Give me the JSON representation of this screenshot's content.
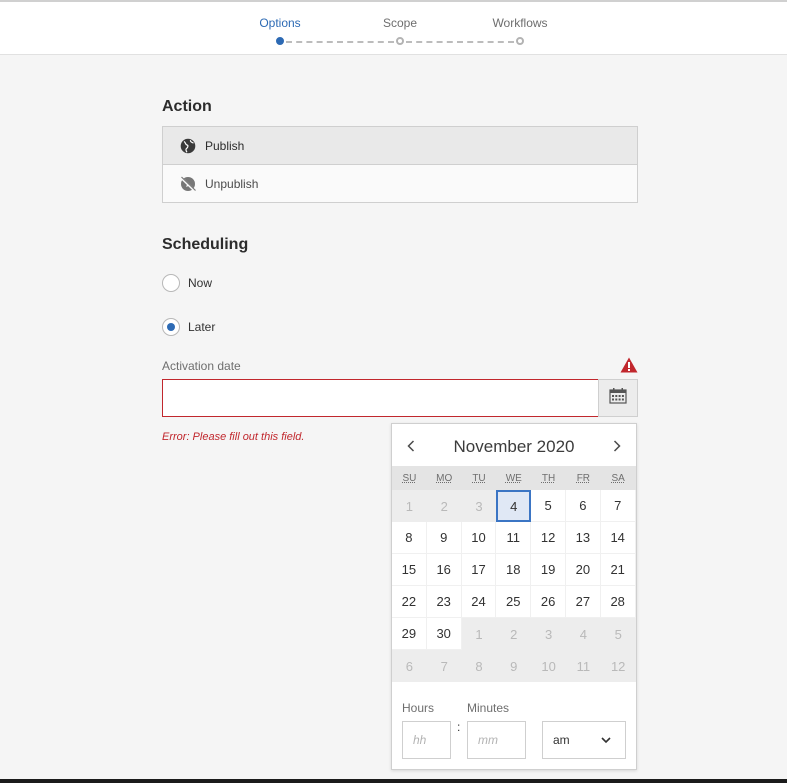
{
  "wizard": {
    "steps": [
      {
        "label": "Options",
        "active": true
      },
      {
        "label": "Scope",
        "active": false
      },
      {
        "label": "Workflows",
        "active": false
      }
    ]
  },
  "action": {
    "title": "Action",
    "items": [
      {
        "label": "Publish",
        "icon": "globe-icon",
        "selected": true
      },
      {
        "label": "Unpublish",
        "icon": "globe-off-icon",
        "selected": false
      }
    ]
  },
  "scheduling": {
    "title": "Scheduling",
    "options": [
      {
        "label": "Now",
        "checked": false
      },
      {
        "label": "Later",
        "checked": true
      }
    ]
  },
  "activation": {
    "label": "Activation date",
    "value": "",
    "error": "Error: Please fill out this field."
  },
  "calendar": {
    "month_year": "November 2020",
    "weekdays": [
      "SU",
      "MO",
      "TU",
      "WE",
      "TH",
      "FR",
      "SA"
    ],
    "weeks": [
      [
        "1",
        "2",
        "3",
        "4",
        "5",
        "6",
        "7"
      ],
      [
        "8",
        "9",
        "10",
        "11",
        "12",
        "13",
        "14"
      ],
      [
        "15",
        "16",
        "17",
        "18",
        "19",
        "20",
        "21"
      ],
      [
        "22",
        "23",
        "24",
        "25",
        "26",
        "27",
        "28"
      ],
      [
        "29",
        "30",
        "1",
        "2",
        "3",
        "4",
        "5"
      ],
      [
        "6",
        "7",
        "8",
        "9",
        "10",
        "11",
        "12"
      ]
    ],
    "today": "4",
    "hours_label": "Hours",
    "minutes_label": "Minutes",
    "hours_placeholder": "hh",
    "minutes_placeholder": "mm",
    "separator": ":",
    "period": "am"
  },
  "colors": {
    "accent": "#2d6ab4",
    "error": "#c1272d"
  }
}
